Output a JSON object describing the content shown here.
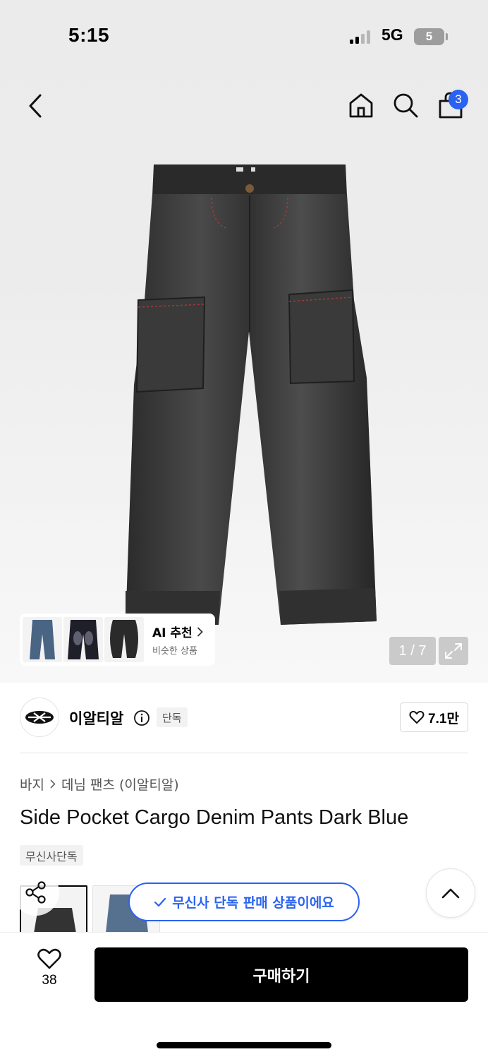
{
  "status_bar": {
    "time": "5:15",
    "network": "5G",
    "battery": "5"
  },
  "nav": {
    "cart_count": "3"
  },
  "ai_recommend": {
    "title": "AI 추천",
    "subtitle": "비슷한 상품"
  },
  "gallery": {
    "page_counter": "1 / 7"
  },
  "brand": {
    "name": "이알티알",
    "exclusive_tag": "단독",
    "likes": "7.1만"
  },
  "breadcrumb": {
    "category": "바지",
    "subcategory": "데님 팬츠 (이알티알)"
  },
  "product": {
    "title": "Side Pocket Cargo Denim Pants Dark Blue",
    "tag": "무신사단독"
  },
  "toast": {
    "message": "무신사 단독 판매 상품이에요"
  },
  "bottom_bar": {
    "wish_count": "38",
    "buy_label": "구매하기"
  },
  "colors": {
    "accent": "#2a63f0",
    "primary_button": "#000000"
  }
}
